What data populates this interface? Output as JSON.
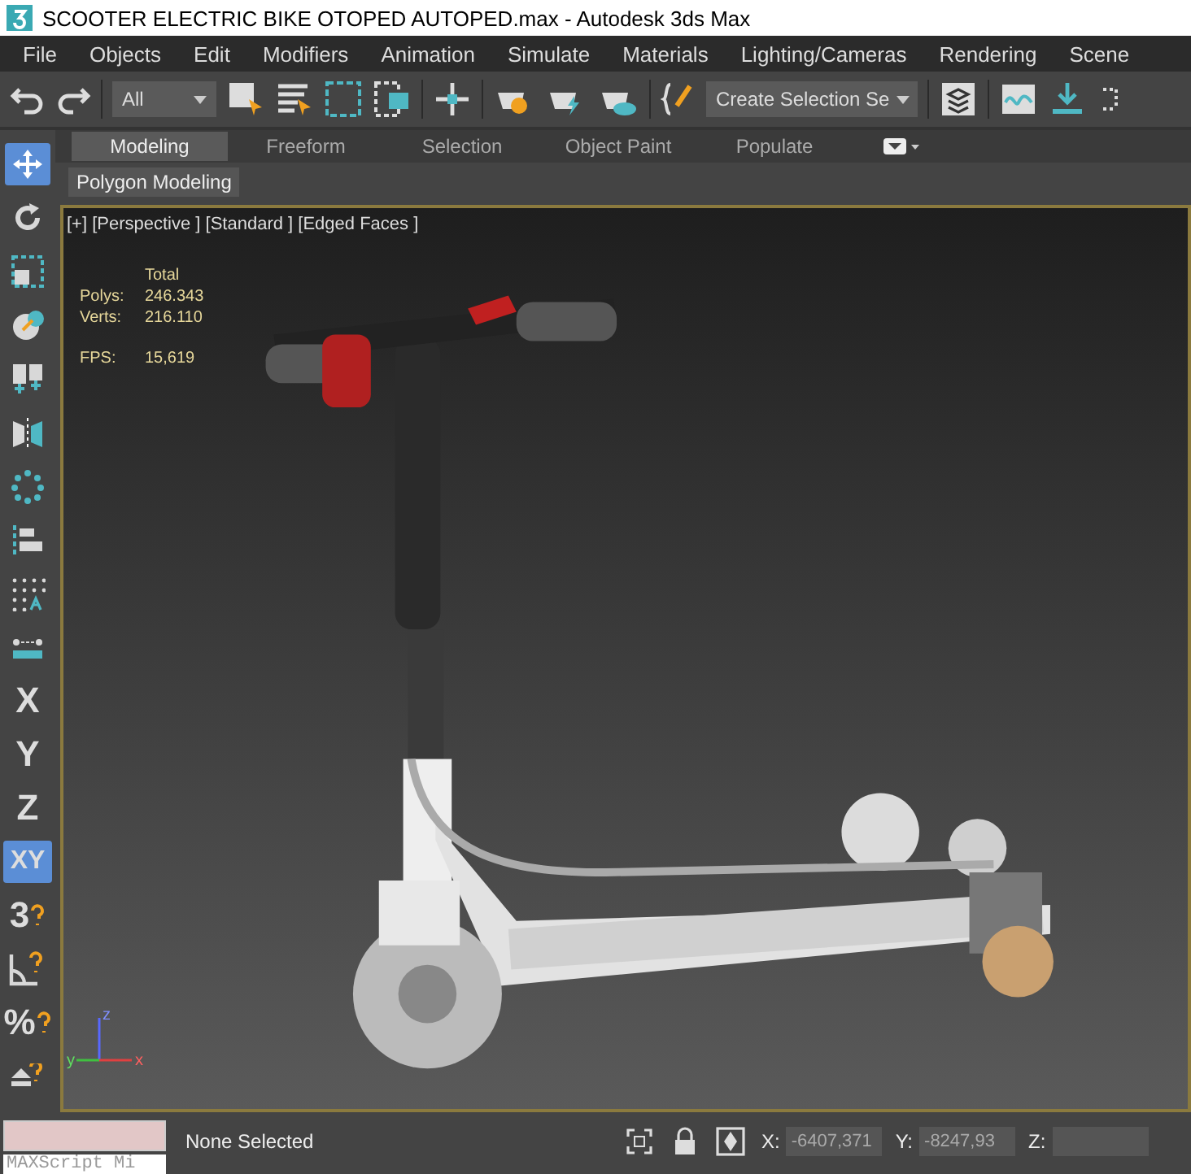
{
  "window": {
    "title": "SCOOTER ELECTRIC BIKE OTOPED AUTOPED.max - Autodesk 3ds Max"
  },
  "menu": [
    "File",
    "Objects",
    "Edit",
    "Modifiers",
    "Animation",
    "Simulate",
    "Materials",
    "Lighting/Cameras",
    "Rendering",
    "Scene"
  ],
  "toolbar": {
    "filter": "All",
    "selection_set": "Create Selection Se"
  },
  "ribbon": {
    "tabs": [
      {
        "label": "Modeling",
        "selected": true
      },
      {
        "label": "Freeform",
        "selected": false
      },
      {
        "label": "Selection",
        "selected": false
      },
      {
        "label": "Object Paint",
        "selected": false
      },
      {
        "label": "Populate",
        "selected": false
      }
    ],
    "panel": "Polygon Modeling"
  },
  "left_tools": [
    {
      "kind": "move",
      "selected": true
    },
    {
      "kind": "rotate",
      "selected": false
    },
    {
      "kind": "scale",
      "selected": false
    },
    {
      "kind": "place",
      "selected": false
    },
    {
      "kind": "pivot",
      "selected": false
    },
    {
      "kind": "mirror",
      "selected": false
    },
    {
      "kind": "array",
      "selected": false
    },
    {
      "kind": "align",
      "selected": false
    },
    {
      "kind": "grid",
      "selected": false
    },
    {
      "kind": "measure",
      "selected": false
    }
  ],
  "axis_buttons": [
    {
      "label": "X",
      "selected": false
    },
    {
      "label": "Y",
      "selected": false
    },
    {
      "label": "Z",
      "selected": false
    },
    {
      "label": "XY",
      "selected": true
    }
  ],
  "snap_tools": [
    {
      "kind": "snap",
      "label": "3"
    },
    {
      "kind": "angle"
    },
    {
      "kind": "percent",
      "label": "%"
    },
    {
      "kind": "spinner"
    }
  ],
  "viewport": {
    "label": "[+] [Perspective ] [Standard ] [Edged Faces ]",
    "stats": {
      "header": "Total",
      "rows": [
        {
          "label": "Polys:",
          "value": "246.343"
        },
        {
          "label": "Verts:",
          "value": "216.110"
        },
        {
          "label": "FPS:",
          "value": "15,619"
        }
      ]
    },
    "gizmo": {
      "x": "x",
      "y": "y",
      "z": "z"
    }
  },
  "status_bar": {
    "maxscript": "MAXScript Mi",
    "prompt": "None Selected",
    "coords": [
      {
        "label": "X:",
        "value": "-6407,371"
      },
      {
        "label": "Y:",
        "value": "-8247,93"
      },
      {
        "label": "Z:"
      }
    ]
  }
}
